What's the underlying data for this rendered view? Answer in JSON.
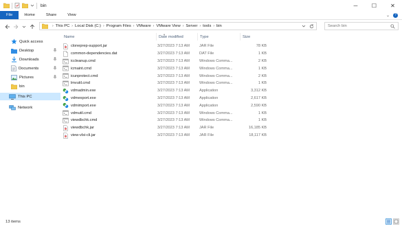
{
  "window": {
    "title": "bin",
    "controls": {
      "minimize": "─",
      "maximize": "☐",
      "close": "✕"
    }
  },
  "ribbon": {
    "tabs": [
      "File",
      "Home",
      "Share",
      "View"
    ],
    "expand": "⌄",
    "help": "?"
  },
  "address": {
    "crumbs": [
      "This PC",
      "Local Disk (C:)",
      "Program Files",
      "VMware",
      "VMware View",
      "Server",
      "tools",
      "bin"
    ],
    "search_placeholder": "Search bin"
  },
  "nav": {
    "items": [
      {
        "label": "Quick access",
        "icon": "star-icon",
        "pinned": false
      },
      {
        "label": "Desktop",
        "icon": "desktop-folder-icon",
        "pinned": true
      },
      {
        "label": "Downloads",
        "icon": "downloads-folder-icon",
        "pinned": true
      },
      {
        "label": "Documents",
        "icon": "documents-folder-icon",
        "pinned": true
      },
      {
        "label": "Pictures",
        "icon": "pictures-folder-icon",
        "pinned": true
      },
      {
        "label": "bin",
        "icon": "folder-icon",
        "pinned": false
      },
      {
        "label": "This PC",
        "icon": "computer-icon",
        "pinned": false,
        "selected": true
      },
      {
        "label": "Network",
        "icon": "network-icon",
        "pinned": false
      }
    ],
    "pin_glyph": "📌"
  },
  "columns": {
    "name": "Name",
    "date": "Date modified",
    "type": "Type",
    "size": "Size"
  },
  "files": [
    {
      "name": "cloneprep-support.jar",
      "date": "3/27/2023 7:13 AM",
      "type": "JAR File",
      "size": "78 KB",
      "icon": "jar-file-icon"
    },
    {
      "name": "common-dependencies.dat",
      "date": "3/27/2023 7:13 AM",
      "type": "DAT File",
      "size": "1 KB",
      "icon": "file-icon"
    },
    {
      "name": "iccleanup.cmd",
      "date": "3/27/2023 7:13 AM",
      "type": "Windows Comma...",
      "size": "2 KB",
      "icon": "cmd-file-icon"
    },
    {
      "name": "icmaint.cmd",
      "date": "3/27/2023 7:13 AM",
      "type": "Windows Comma...",
      "size": "1 KB",
      "icon": "cmd-file-icon"
    },
    {
      "name": "icunprotect.cmd",
      "date": "3/27/2023 7:13 AM",
      "type": "Windows Comma...",
      "size": "2 KB",
      "icon": "cmd-file-icon"
    },
    {
      "name": "lmvutil.cmd",
      "date": "3/27/2023 7:13 AM",
      "type": "Windows Comma...",
      "size": "1 KB",
      "icon": "cmd-file-icon"
    },
    {
      "name": "vdmadmin.exe",
      "date": "3/27/2023 7:13 AM",
      "type": "Application",
      "size": "3,312 KB",
      "icon": "app-icon"
    },
    {
      "name": "vdmexport.exe",
      "date": "3/27/2023 7:13 AM",
      "type": "Application",
      "size": "2,617 KB",
      "icon": "app-icon"
    },
    {
      "name": "vdmimport.exe",
      "date": "3/27/2023 7:13 AM",
      "type": "Application",
      "size": "2,590 KB",
      "icon": "app-icon"
    },
    {
      "name": "vdmutil.cmd",
      "date": "3/27/2023 7:13 AM",
      "type": "Windows Comma...",
      "size": "1 KB",
      "icon": "cmd-file-icon"
    },
    {
      "name": "viewdbchk.cmd",
      "date": "3/27/2023 7:13 AM",
      "type": "Windows Comma...",
      "size": "1 KB",
      "icon": "cmd-file-icon"
    },
    {
      "name": "viewdbchk.jar",
      "date": "3/27/2023 7:13 AM",
      "type": "JAR File",
      "size": "16,185 KB",
      "icon": "jar-file-icon"
    },
    {
      "name": "view-vlsi-cli.jar",
      "date": "3/27/2023 7:13 AM",
      "type": "JAR File",
      "size": "18,117 KB",
      "icon": "jar-file-icon"
    }
  ],
  "status": {
    "count": "13 items"
  },
  "colors": {
    "accent": "#1565c0",
    "selection": "#cce8ff",
    "folder": "#f2c94c",
    "header_text": "#4c607a"
  }
}
